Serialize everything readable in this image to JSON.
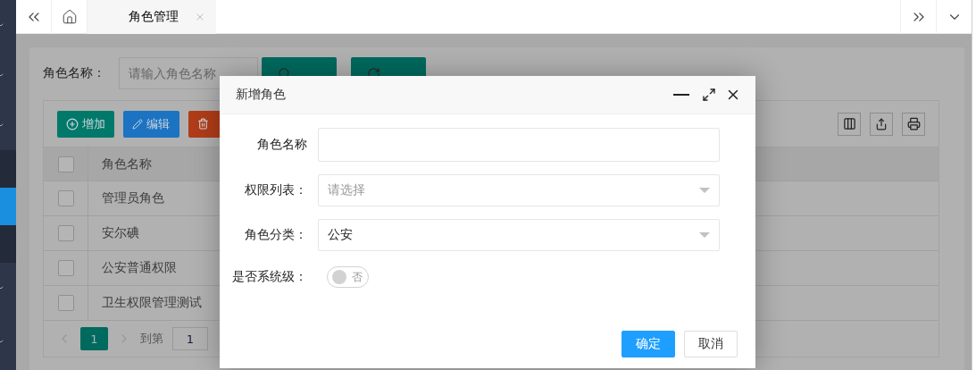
{
  "sidebar": {
    "items": [
      {
        "kind": "group",
        "selected": false
      },
      {
        "kind": "group",
        "selected": false
      },
      {
        "kind": "group",
        "selected": false
      },
      {
        "kind": "item",
        "selected": false
      },
      {
        "kind": "item",
        "selected": true
      },
      {
        "kind": "item",
        "selected": false
      },
      {
        "kind": "group",
        "selected": false
      },
      {
        "kind": "group",
        "selected": false
      }
    ]
  },
  "tabs": [
    {
      "label": "角色管理",
      "selected": true
    }
  ],
  "search": {
    "label": "角色名称：",
    "placeholder": "请输入角色名称",
    "buttons": [
      {
        "kind": "query"
      },
      {
        "kind": "reset"
      }
    ]
  },
  "toolbar": {
    "buttons": [
      {
        "kind": "add",
        "label": "增加"
      },
      {
        "kind": "edit",
        "label": "编辑"
      },
      {
        "kind": "delete"
      }
    ]
  },
  "table": {
    "columns": [
      "角色名称"
    ],
    "header_checked": false,
    "rows": [
      {
        "name": "管理员角色",
        "checked": false
      },
      {
        "name": "安尔碘",
        "checked": false
      },
      {
        "name": "公安普通权限",
        "checked": false
      },
      {
        "name": "卫生权限管理测试",
        "checked": false
      }
    ]
  },
  "pagination": {
    "pages": [
      {
        "label": "1",
        "selected": true
      }
    ],
    "goto_label": "到第",
    "goto_value": "1"
  },
  "dialog": {
    "title": "新增角色",
    "fields": [
      {
        "kind": "text",
        "label": "角色名称"
      },
      {
        "kind": "select",
        "label": "权限列表：",
        "placeholder": "请选择"
      },
      {
        "kind": "select",
        "label": "角色分类：",
        "value": "公安"
      },
      {
        "kind": "switch",
        "label": "是否系统级：",
        "on": false,
        "text": "否"
      }
    ],
    "buttons": [
      {
        "kind": "primary",
        "label": "确定"
      },
      {
        "kind": "default",
        "label": "取消"
      }
    ]
  }
}
